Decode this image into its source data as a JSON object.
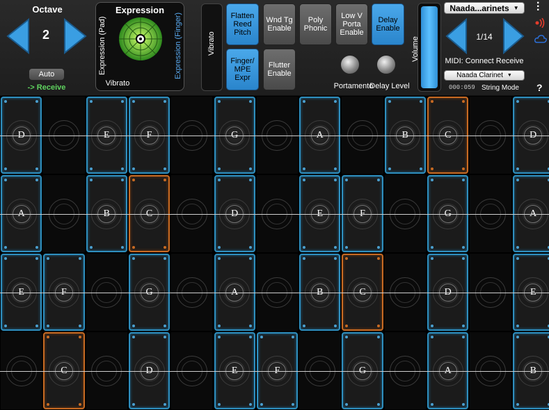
{
  "octave": {
    "title": "Octave",
    "value": "2",
    "auto_label": "Auto",
    "receive_label": "-> Receive"
  },
  "expression": {
    "title": "Expression",
    "pad_label": "Expression (Pad)",
    "finger_label": "Expression (Finger)",
    "vibrato_label": "Vibrato"
  },
  "vibrato_slider": {
    "label": "Vibrato"
  },
  "buttons": {
    "flatten": "Flatten Reed Pitch",
    "wnd_tg": "Wnd Tg Enable",
    "poly": "Poly Phonic",
    "lowv": "Low V Porta Enable",
    "delay": "Delay Enable",
    "finger_mpe": "Finger/ MPE Expr",
    "flutter": "Flutter Enable"
  },
  "knobs": {
    "portamento": "Portamento",
    "delay_level": "Delay Level"
  },
  "volume": {
    "label": "Volume"
  },
  "preset": {
    "bank": "Naada...arinets",
    "position": "1/14",
    "midi": "MIDI: Connect Receive",
    "instrument": "Naada Clarinet",
    "time": "000:059",
    "mode": "String Mode"
  },
  "icons": {
    "menu": "more-vertical-icon",
    "signal": "broadcast-icon",
    "cloud": "cloud-icon",
    "help": "?"
  },
  "colors": {
    "blue": "#2e8fbf",
    "orange": "#c86a22",
    "button_blue": "#3b98dd",
    "receive_green": "#5fd35f"
  },
  "grid": {
    "rows": [
      [
        "D",
        "",
        "E",
        "F",
        "",
        "G",
        "",
        "A",
        "",
        "B",
        "C",
        "",
        "D"
      ],
      [
        "A",
        "",
        "B",
        "C",
        "",
        "D",
        "",
        "E",
        "F",
        "",
        "G",
        "",
        "A"
      ],
      [
        "E",
        "F",
        "",
        "G",
        "",
        "A",
        "",
        "B",
        "C",
        "",
        "D",
        "",
        "E"
      ],
      [
        "",
        "C",
        "",
        "D",
        "",
        "E",
        "F",
        "",
        "G",
        "",
        "A",
        "",
        "B"
      ]
    ],
    "highlighted": [
      [
        0,
        10
      ],
      [
        1,
        3
      ],
      [
        2,
        8
      ],
      [
        3,
        1
      ]
    ]
  }
}
